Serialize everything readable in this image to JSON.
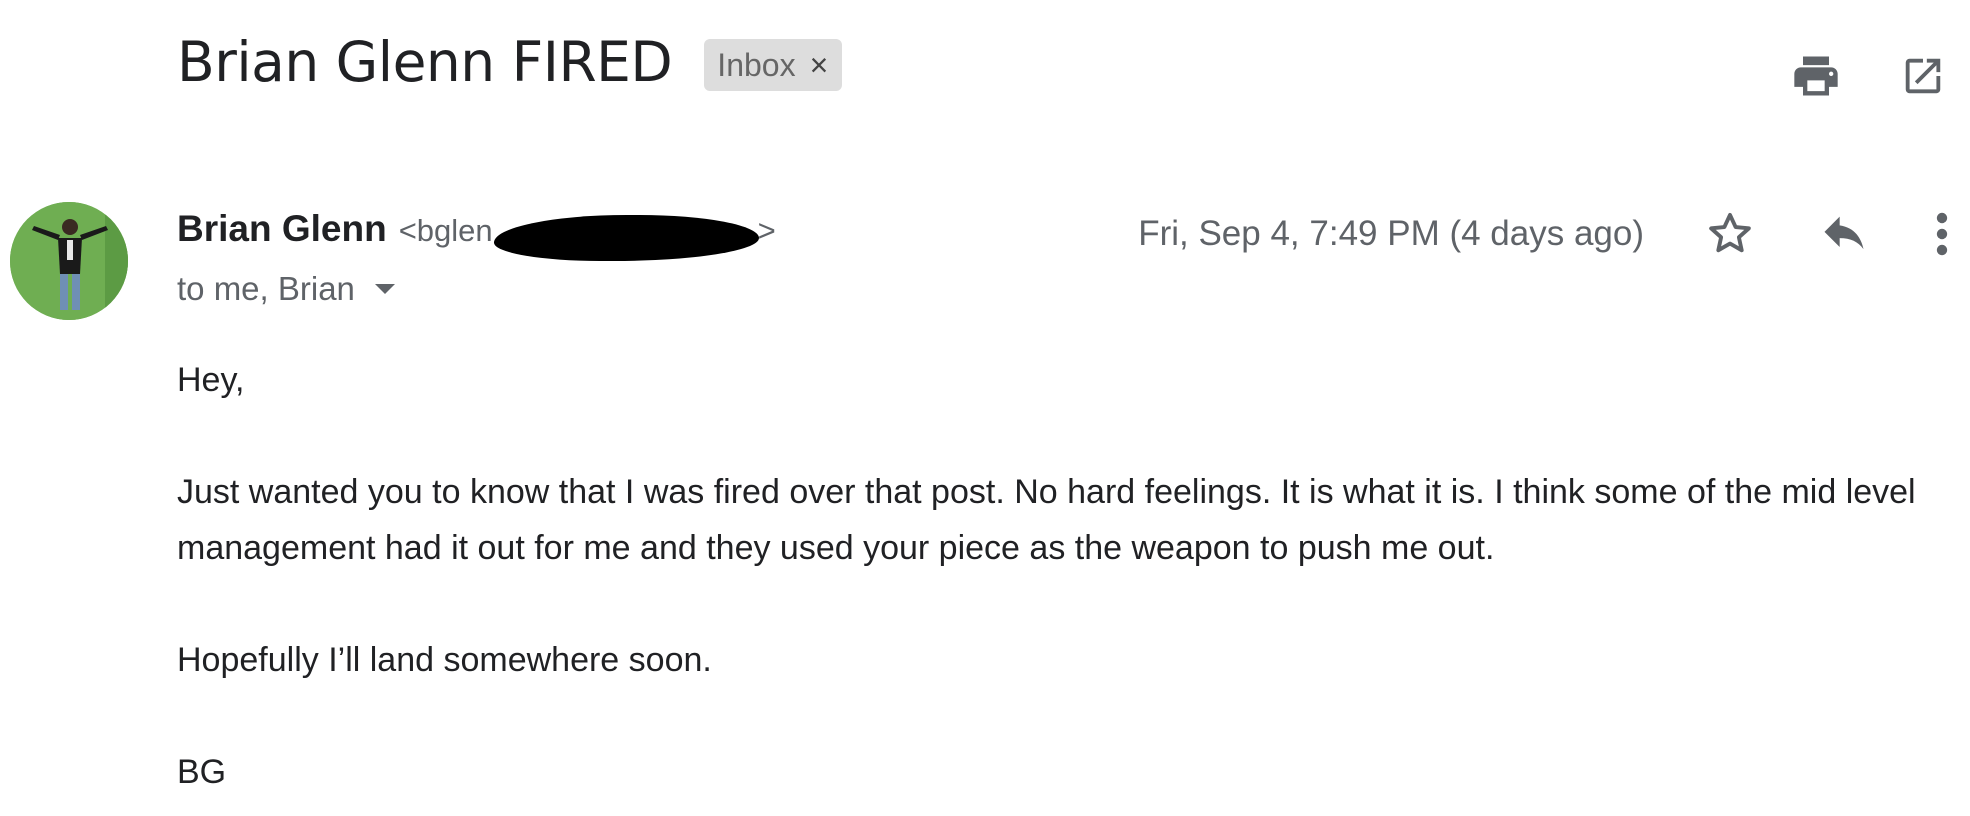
{
  "subject": {
    "title": "Brian Glenn FIRED",
    "label": "Inbox",
    "label_remove": "×"
  },
  "toolbar": {
    "print_icon": "print-icon",
    "open_new_window_icon": "open-in-new-window-icon"
  },
  "message": {
    "sender_name": "Brian Glenn",
    "sender_email_visible": "<bglen",
    "sender_email_tail": ">",
    "recipients": "to me, Brian",
    "date": "Fri, Sep 4, 7:49 PM (4 days ago)",
    "icons": [
      "star-icon",
      "reply-icon",
      "more-vert-icon"
    ]
  },
  "body": {
    "greeting": "Hey,",
    "paragraph1": "Just wanted you to know that I was fired over that post. No hard feelings. It is what it is. I think some of the mid level management had it out for me and they used your piece as the weapon to push me out.",
    "paragraph2": "Hopefully I’ll land somewhere soon.",
    "signoff": "BG"
  },
  "colors": {
    "text": "#202124",
    "muted": "#5f6368",
    "chip_bg": "#dddddd",
    "avatar_bg": "#6aa84f"
  }
}
